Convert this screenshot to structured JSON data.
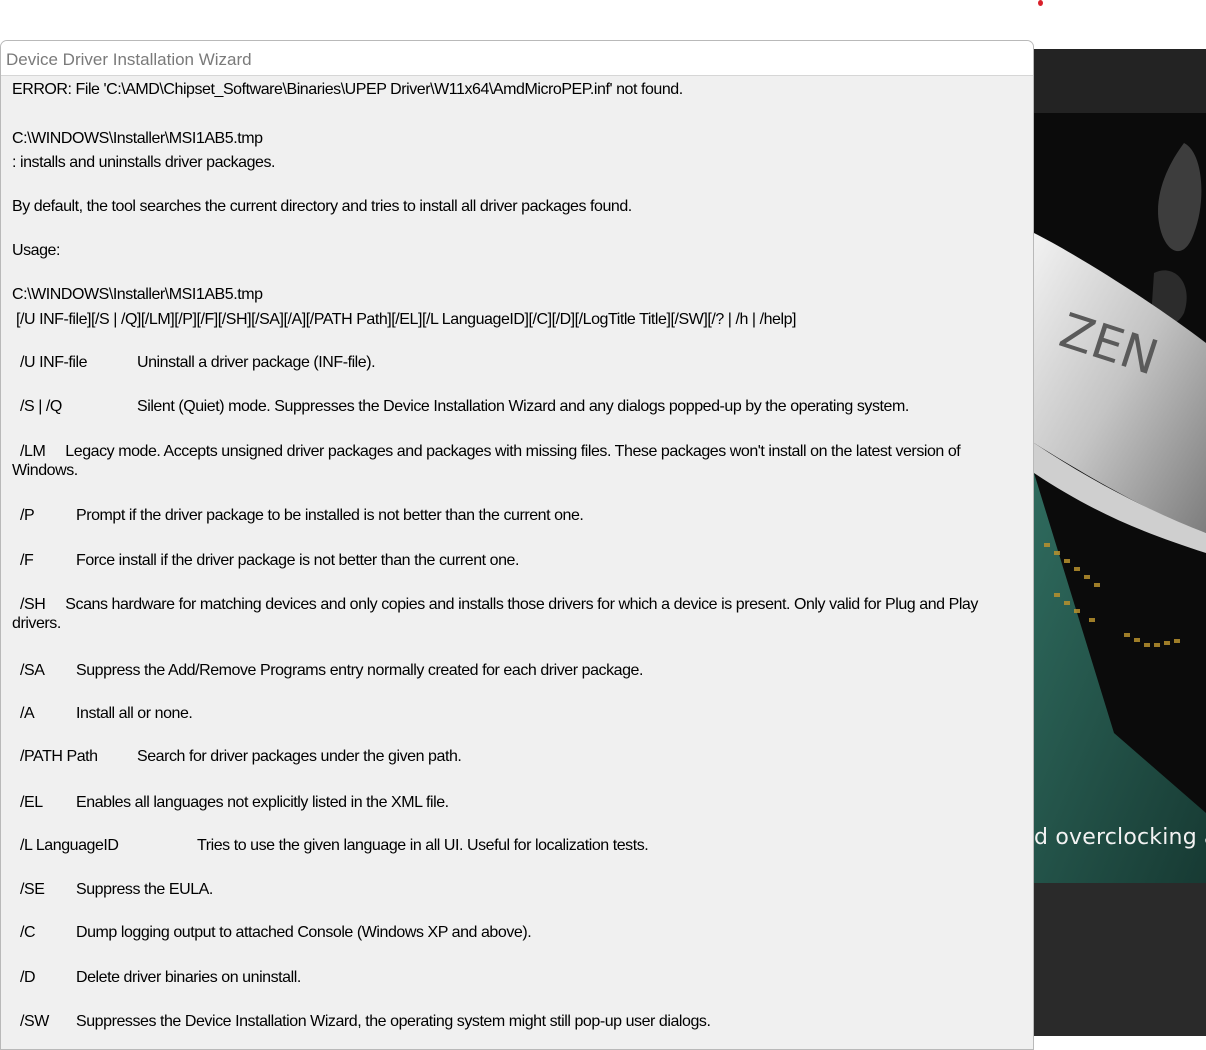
{
  "dialog": {
    "title": "Device Driver Installation Wizard",
    "error": "ERROR: File 'C:\\AMD\\Chipset_Software\\Binaries\\UPEP Driver\\W11x64\\AmdMicroPEP.inf' not found.",
    "tmp_path_1": "C:\\WINDOWS\\Installer\\MSI1AB5.tmp",
    "summary": ": installs and uninstalls driver packages.",
    "default_behaviour": "By default, the tool searches the current directory and tries to install all driver packages found.",
    "usage_label": "Usage:",
    "tmp_path_2": "C:\\WINDOWS\\Installer\\MSI1AB5.tmp",
    "usage_syntax": " [/U INF-file][/S | /Q][/LM][/P][/F][/SH][/SA][/A][/PATH Path][/EL][/L LanguageID][/C][/D][/LogTitle Title][/SW][/? | /h | /help]",
    "options": {
      "u": {
        "switch": "/U INF-file",
        "desc": "Uninstall a driver package (INF-file)."
      },
      "s": {
        "switch": "/S | /Q",
        "desc": "Silent (Quiet) mode. Suppresses the Device Installation Wizard and any dialogs popped-up by the operating system."
      },
      "lm": {
        "text": "  /LM     Legacy mode. Accepts unsigned driver packages and packages with missing files. These packages won't install on the latest version of Windows."
      },
      "p": {
        "switch": "/P",
        "desc": "Prompt if the driver package to be installed is not better than the current one."
      },
      "f": {
        "switch": "/F",
        "desc": "Force install if the driver package is not better than the current one."
      },
      "sh": {
        "text": "  /SH     Scans hardware for matching devices and only copies and installs those drivers for which a device is present. Only valid for Plug and Play drivers."
      },
      "sa": {
        "switch": "/SA",
        "desc": "Suppress the Add/Remove Programs entry normally created for each driver package."
      },
      "a": {
        "switch": "/A",
        "desc": "Install all or none."
      },
      "path": {
        "switch": "/PATH Path",
        "desc": "Search for driver packages under the given path."
      },
      "el": {
        "switch": "/EL",
        "desc": "Enables all languages not explicitly listed in the XML file."
      },
      "l": {
        "switch": "/L LanguageID",
        "desc": "Tries to use the given language in all UI. Useful for localization tests."
      },
      "se": {
        "switch": "/SE",
        "desc": "Suppress the EULA."
      },
      "c": {
        "switch": "/C",
        "desc": "Dump logging output to attached Console (Windows XP and above)."
      },
      "d": {
        "switch": "/D",
        "desc": "Delete driver binaries on uninstall."
      },
      "sw": {
        "switch": "/SW",
        "desc": "Suppresses the Device Installation Wizard, the operating system might still pop-up user dialogs."
      }
    }
  },
  "background_app": {
    "caption": "d overclocking a",
    "logo_text": "ZEN"
  },
  "colors": {
    "dialog_bg": "#f0f0f0",
    "title_text": "#7a7a7a",
    "background_app": "#1c1c1c",
    "red_dot": "#d9202a"
  }
}
